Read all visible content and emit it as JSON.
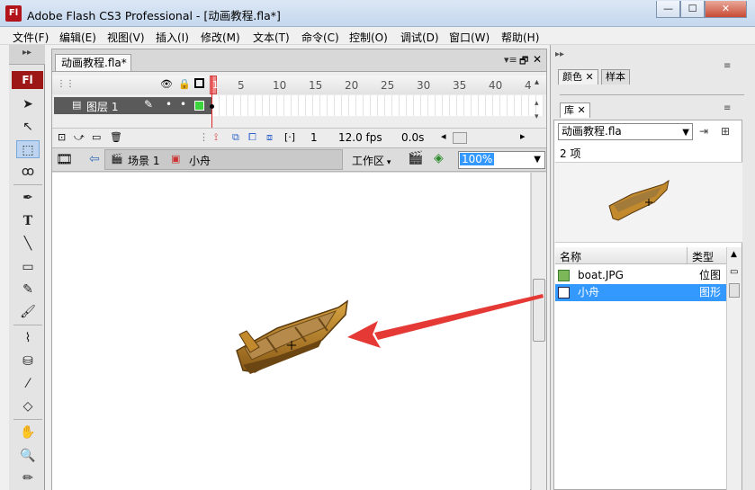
{
  "window": {
    "title": "Adobe Flash CS3 Professional - [动画教程.fla*]",
    "logo": "Fl"
  },
  "menu": [
    "文件(F)",
    "编辑(E)",
    "视图(V)",
    "插入(I)",
    "修改(M)",
    "文本(T)",
    "命令(C)",
    "控制(O)",
    "调试(D)",
    "窗口(W)",
    "帮助(H)"
  ],
  "tools": {
    "badge": "Fl"
  },
  "document": {
    "tab": "动画教程.fla*"
  },
  "timeline": {
    "frame_numbers": [
      "1",
      "5",
      "10",
      "15",
      "20",
      "25",
      "30",
      "35",
      "40",
      "4"
    ],
    "layer_name": "图层 1",
    "current_frame": "1",
    "fps": "12.0 fps",
    "time": "0.0s"
  },
  "editbar": {
    "scene": "场景 1",
    "symbol": "小舟",
    "workspace": "工作区",
    "zoom": "100%"
  },
  "panels": {
    "color_tab": "颜色",
    "swatch_tab": "样本",
    "library_tab": "库",
    "library_file": "动画教程.fla",
    "item_count": "2 项",
    "col_name": "名称",
    "col_type": "类型",
    "items": [
      {
        "name": "boat.JPG",
        "type": "位图",
        "selected": false
      },
      {
        "name": "小舟",
        "type": "图形",
        "selected": true
      }
    ]
  },
  "colors": {
    "accent_red": "#e53935",
    "selection_blue": "#3399ff",
    "flash_red": "#9e1717"
  }
}
